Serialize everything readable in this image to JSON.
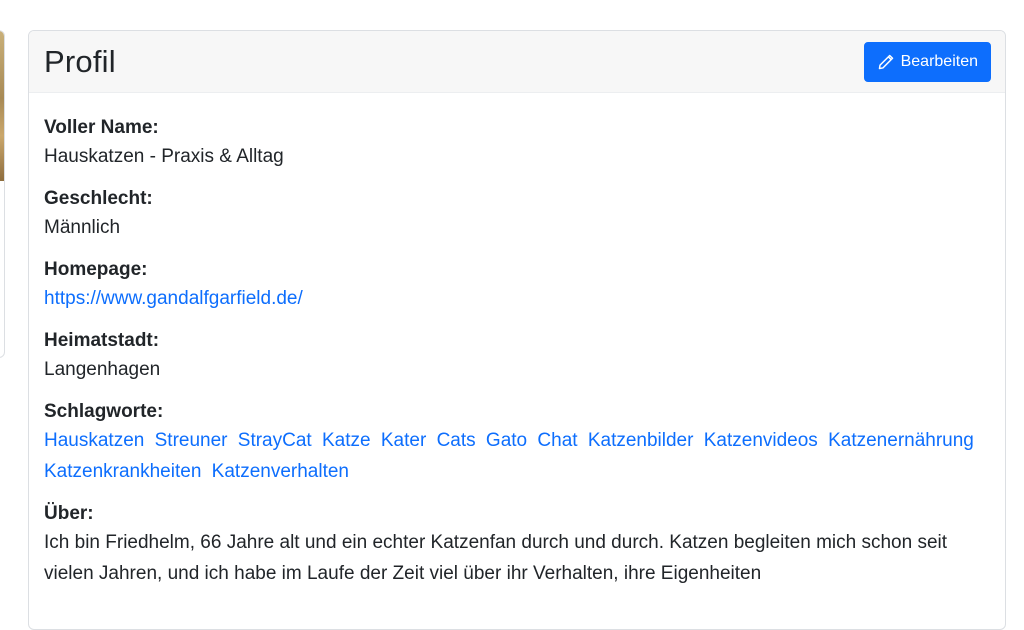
{
  "profile": {
    "title": "Profil",
    "edit_label": "Bearbeiten",
    "fields": {
      "full_name": {
        "label": "Voller Name:",
        "value": "Hauskatzen - Praxis & Alltag"
      },
      "gender": {
        "label": "Geschlecht:",
        "value": "Männlich"
      },
      "homepage": {
        "label": "Homepage:",
        "value": "https://www.gandalfgarfield.de/"
      },
      "hometown": {
        "label": "Heimatstadt:",
        "value": "Langenhagen"
      },
      "tags": {
        "label": "Schlagworte:",
        "items": [
          "Hauskatzen",
          "Streuner",
          "StrayCat",
          "Katze",
          "Kater",
          "Cats",
          "Gato",
          "Chat",
          "Katzenbilder",
          "Katzenvideos",
          "Katzenernährung",
          "Katzenkrankheiten",
          "Katzenverhalten"
        ]
      },
      "about": {
        "label": "Über:",
        "value": "Ich bin Friedhelm, 66 Jahre alt und ein echter Katzenfan durch und durch. Katzen begleiten mich schon seit vielen Jahren, und ich habe im Laufe der Zeit viel über ihr Verhalten, ihre Eigenheiten"
      }
    }
  },
  "colors": {
    "primary": "#0d6efd",
    "header_bg": "#f7f7f7",
    "border": "#dcdfe3"
  },
  "icons": {
    "edit": "pencil-icon"
  }
}
